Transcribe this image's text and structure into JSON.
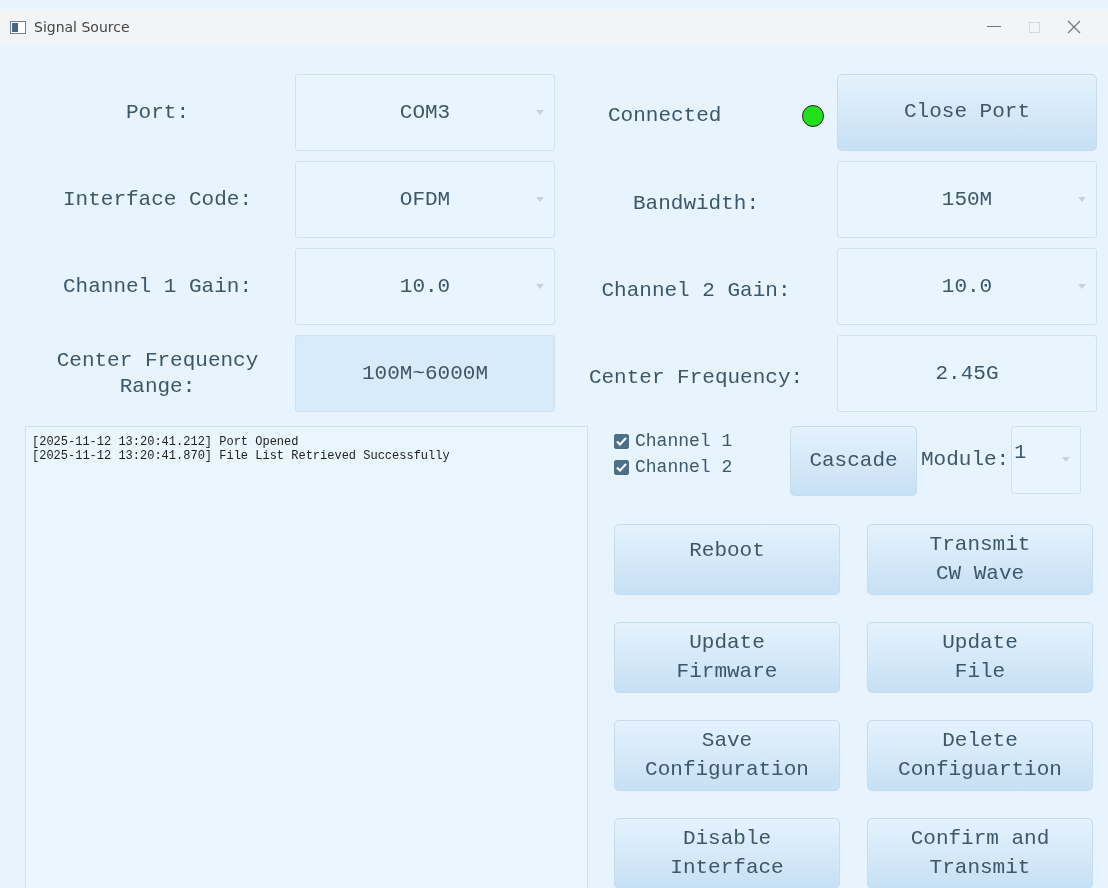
{
  "window": {
    "title": "Signal Source"
  },
  "settings": [
    {
      "left": {
        "label": "Port:",
        "kind": "dropdown",
        "value": "COM3"
      },
      "right": {
        "kind": "status",
        "text": "Connected",
        "connected": true,
        "button": "Close Port"
      }
    },
    {
      "left": {
        "label": "Interface Code:",
        "kind": "dropdown",
        "value": "OFDM"
      },
      "right": {
        "kind": "dropdown",
        "label": "Bandwidth:",
        "value": "150M"
      }
    },
    {
      "left": {
        "label": "Channel 1 Gain:",
        "kind": "dropdown",
        "value": "10.0"
      },
      "right": {
        "kind": "dropdown",
        "label": "Channel 2 Gain:",
        "value": "10.0"
      }
    },
    {
      "left": {
        "label": "Center Frequency Range:",
        "kind": "readonly",
        "value": "100M~6000M"
      },
      "right": {
        "kind": "input",
        "label": "Center Frequency:",
        "value": "2.45G"
      }
    }
  ],
  "log": [
    "[2025-11-12 13:20:41.212] Port Opened",
    "[2025-11-12 13:20:41.870] File List Retrieved Successfully"
  ],
  "channels": [
    {
      "label": "Channel 1",
      "checked": true
    },
    {
      "label": "Channel 2",
      "checked": true
    }
  ],
  "cascade_button": "Cascade",
  "module": {
    "label": "Module:",
    "value": "1"
  },
  "actions": [
    {
      "lines": [
        "Reboot"
      ]
    },
    {
      "lines": [
        "Transmit",
        "CW Wave"
      ]
    },
    {
      "lines": [
        "Update",
        "Firmware"
      ]
    },
    {
      "lines": [
        "Update",
        "File"
      ]
    },
    {
      "lines": [
        "Save",
        "Configuration"
      ]
    },
    {
      "lines": [
        "Delete",
        "Configuartion"
      ]
    },
    {
      "lines": [
        "Disable",
        "Interface"
      ]
    },
    {
      "lines": [
        "Confirm and",
        "Transmit"
      ]
    }
  ]
}
